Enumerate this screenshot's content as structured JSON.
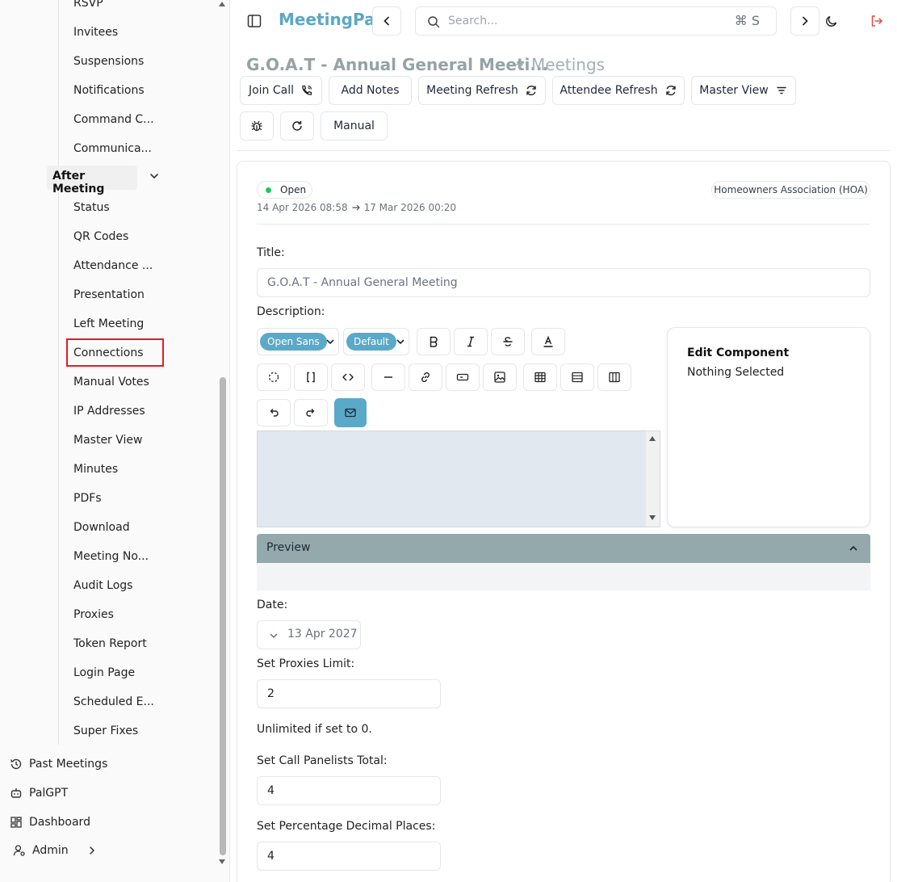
{
  "sidebar": {
    "top_items": [
      "RSVP",
      "Invitees",
      "Suspensions",
      "Notifications",
      "Command C...",
      "Communica..."
    ],
    "section_label": "After Meeting",
    "section_items": [
      "Status",
      "QR Codes",
      "Attendance ...",
      "Presentation",
      "Left Meeting",
      "Connections",
      "Manual Votes",
      "IP Addresses",
      "Master View",
      "Minutes",
      "PDFs",
      "Download",
      "Meeting No...",
      "Audit Logs",
      "Proxies",
      "Token Report",
      "Login Page",
      "Scheduled E...",
      "Super Fixes"
    ],
    "main_items": [
      {
        "label": "Past Meetings",
        "icon": "history-icon"
      },
      {
        "label": "PalGPT",
        "icon": "bot-icon"
      },
      {
        "label": "Dashboard",
        "icon": "dashboard-icon"
      },
      {
        "label": "Admin",
        "icon": "user-cog-icon"
      }
    ]
  },
  "header": {
    "app_title": "MeetingPal",
    "search_placeholder": "Search...",
    "search_shortcut": "⌘ S"
  },
  "breadcrumb": {
    "title": "G.O.A.T - Annual General Meeti...",
    "link": "Meetings"
  },
  "toolbar": {
    "join_call": "Join Call",
    "add_notes": "Add Notes",
    "meeting_refresh": "Meeting Refresh",
    "attendee_refresh": "Attendee Refresh",
    "master_view": "Master View",
    "manual": "Manual"
  },
  "meeting": {
    "status": "Open",
    "start": "14 Apr 2026 08:58",
    "end": "17 Mar 2026 00:20",
    "organization": "Homeowners Association (HOA)"
  },
  "form": {
    "title_label": "Title:",
    "title_value": "G.O.A.T - Annual General Meeting",
    "description_label": "Description:",
    "font_family": "Open Sans",
    "font_size": "Default",
    "edit_component_heading": "Edit Component",
    "edit_component_state": "Nothing Selected",
    "preview_label": "Preview",
    "date_label": "Date:",
    "date_value": "13 Apr 2027",
    "proxies_label": "Set Proxies Limit:",
    "proxies_value": "2",
    "proxies_help": "Unlimited if set to 0.",
    "panelists_label": "Set Call Panelists Total:",
    "panelists_value": "4",
    "decimals_label": "Set Percentage Decimal Places:",
    "decimals_value": "4"
  },
  "colors": {
    "brand": "#5aa7c6",
    "highlight": "#e11d24",
    "status_open": "#22c55e",
    "preview_bar": "#94a9ab"
  }
}
